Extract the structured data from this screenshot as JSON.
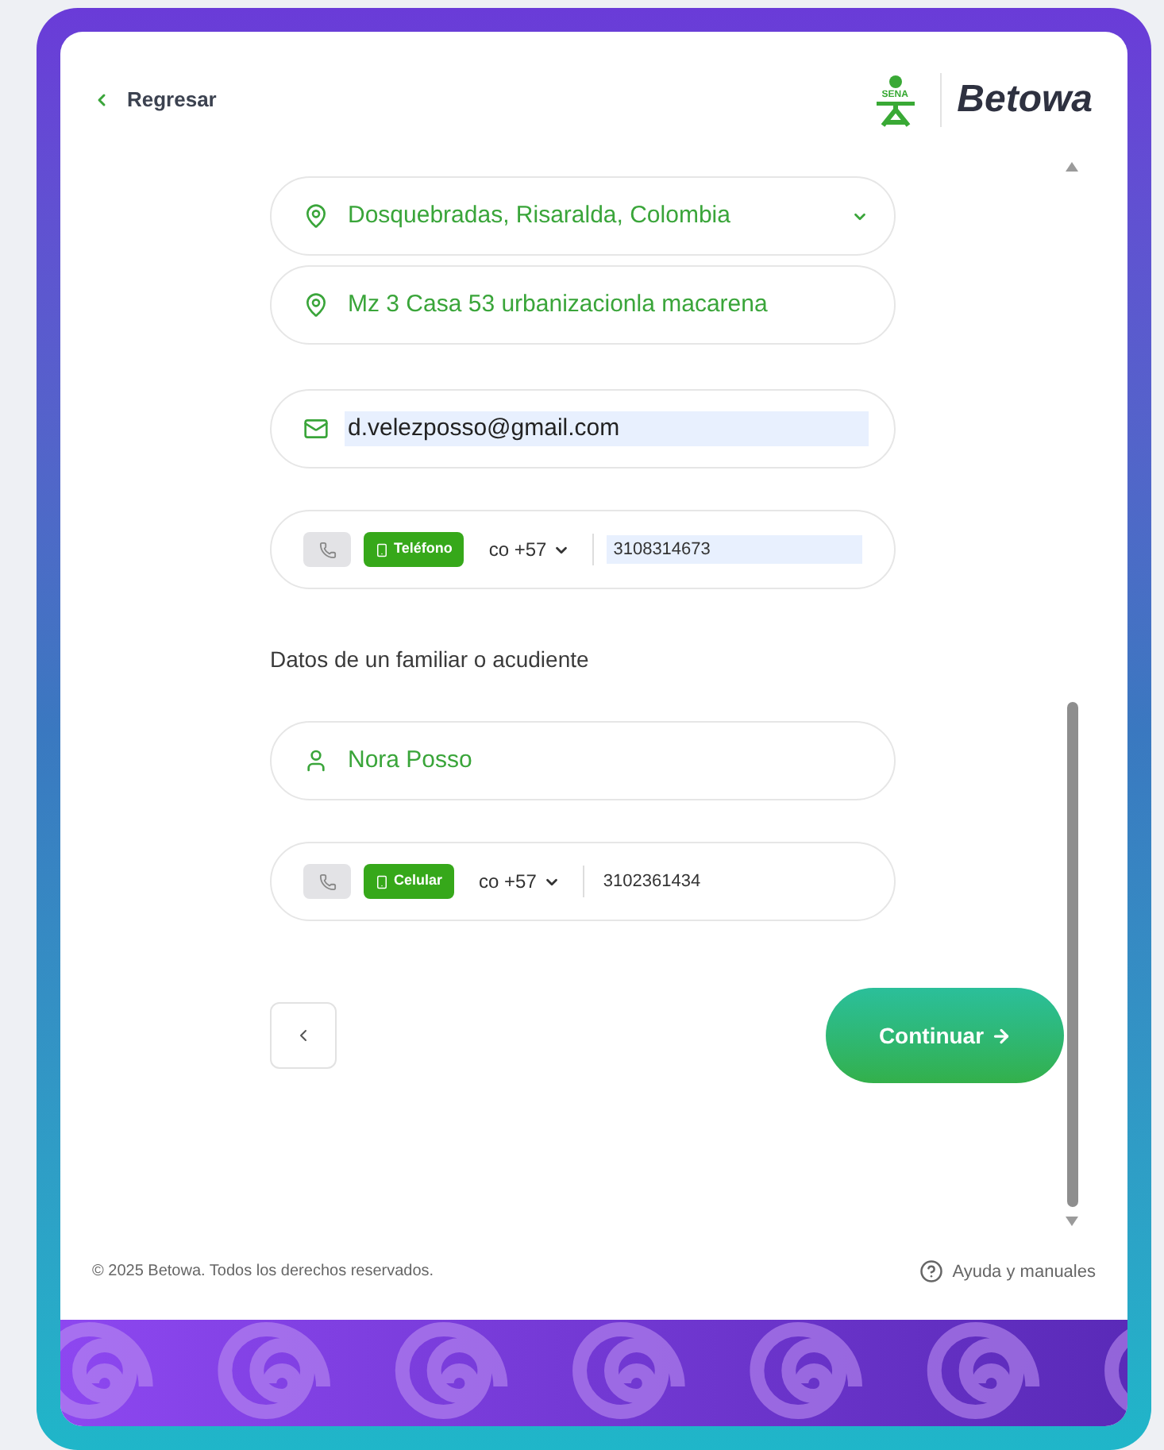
{
  "header": {
    "back_link": "Regresar",
    "logo": {
      "mark": "SENA",
      "name": "Betowa"
    }
  },
  "fields": [
    {
      "kind": "select",
      "value": "Dosquebradas, Risaralda, Colombia",
      "autofilled": false
    },
    {
      "kind": "address",
      "value": "Mz 3 Casa 53 urbanizacionla macarena",
      "autofilled": false
    },
    {
      "kind": "email",
      "value": "d.velezposso@gmail.com",
      "autofilled": true
    },
    {
      "kind": "phone",
      "type_label": "Teléfono",
      "country": "co +57",
      "value": "3108314673",
      "autofilled": true
    },
    {
      "kind": "heading",
      "value": "Datos de un familiar o acudiente"
    },
    {
      "kind": "name",
      "value": "Nora Posso",
      "autofilled": false
    },
    {
      "kind": "phone",
      "type_label": "Celular",
      "country": "co +57",
      "value": "3102361434",
      "autofilled": false
    }
  ],
  "continue_button": "Continuar",
  "footer": {
    "copyright": "© 2025 Betowa. Todos los derechos reservados.",
    "help_link": "Ayuda y manuales"
  }
}
